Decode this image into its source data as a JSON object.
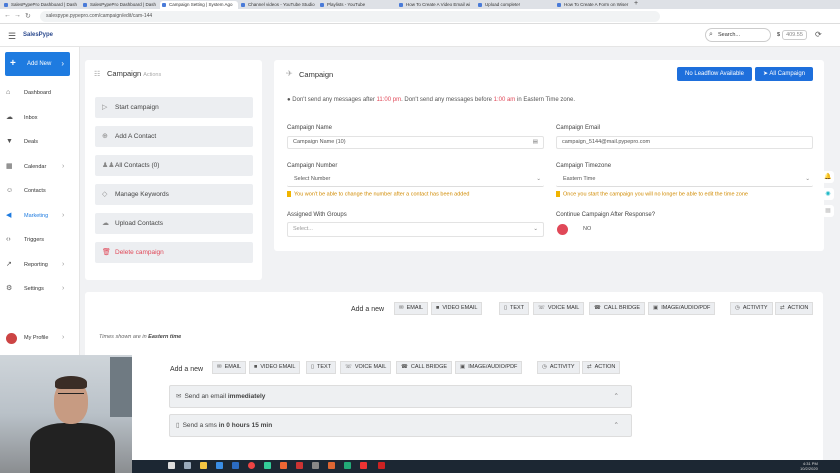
{
  "browser": {
    "tabs": [
      {
        "label": "SalesPypePro Dashboard | Dash",
        "active": false
      },
      {
        "label": "SalesPypePro Dashboard | Dash",
        "active": false
      },
      {
        "label": "Campaign Setting | System Ago",
        "active": true
      },
      {
        "label": "Channel videos - YouTube Studio",
        "active": false
      },
      {
        "label": "Playlists - YouTube",
        "active": false
      },
      {
        "label": "How To Create A Video Email wi",
        "active": false
      },
      {
        "label": "Upload complete!",
        "active": false
      },
      {
        "label": "How To Create A Form on Wiser",
        "active": false
      }
    ],
    "url": "salespype.pypepro.com/campaign/edit/cam-144"
  },
  "header": {
    "logo": "SalesPype",
    "search_placeholder": "Search...",
    "credits_symbol": "$",
    "credits_value": "409.55"
  },
  "sidebar": {
    "add_new": "Add New",
    "items": [
      {
        "label": "Dashboard",
        "icon": "home-icon",
        "chevron": false
      },
      {
        "label": "Inbox",
        "icon": "inbox-icon",
        "chevron": false
      },
      {
        "label": "Deals",
        "icon": "filter-icon",
        "chevron": false
      },
      {
        "label": "Calendar",
        "icon": "calendar-icon",
        "chevron": true
      },
      {
        "label": "Contacts",
        "icon": "contacts-icon",
        "chevron": false
      },
      {
        "label": "Marketing",
        "icon": "megaphone-icon",
        "chevron": true,
        "active": true
      },
      {
        "label": "Triggers",
        "icon": "code-icon",
        "chevron": false
      },
      {
        "label": "Reporting",
        "icon": "chart-icon",
        "chevron": true
      },
      {
        "label": "Settings",
        "icon": "gear-icon",
        "chevron": true
      }
    ],
    "profile": "My Profile"
  },
  "left_panel": {
    "title": "Campaign",
    "subtitle": "Actions",
    "items": [
      {
        "label": "Start campaign",
        "icon": "play-icon"
      },
      {
        "label": "Add A Contact",
        "icon": "add-contact-icon"
      },
      {
        "label": "All Contacts (0)",
        "icon": "users-icon"
      },
      {
        "label": "Manage Keywords",
        "icon": "tag-icon"
      },
      {
        "label": "Upload Contacts",
        "icon": "cloud-upload-icon"
      },
      {
        "label": "Delete campaign",
        "icon": "trash-icon"
      }
    ]
  },
  "right_panel": {
    "title": "Campaign",
    "btn_no_leadflow": "No Leadflow Available",
    "btn_all_campaign": "All Campaign",
    "warning_pre": "Don't send any messages after",
    "warning_after_time": "11:00 pm",
    "warning_mid": ". Don't send any messages before",
    "warning_before_time": "1:00 am",
    "warning_post": "in Eastern Time zone.",
    "campaign_name_label": "Campaign Name",
    "campaign_name_value": "Campaign Name (10)",
    "campaign_email_label": "Campaign Email",
    "campaign_email_value": "campaign_5144@mail.pypepro.com",
    "campaign_number_label": "Campaign Number",
    "campaign_number_value": "Select Number",
    "campaign_number_hint": "You won't be able to change the number after a contact has been added",
    "campaign_timezone_label": "Campaign Timezone",
    "campaign_timezone_value": "Eastern Time",
    "campaign_timezone_hint": "Once you start the campaign you will no longer be able to edit the time zone",
    "groups_label": "Assigned With Groups",
    "groups_placeholder": "Select...",
    "continue_label": "Continue Campaign After Response?",
    "continue_value": "NO"
  },
  "lower": {
    "add_new_label": "Add a new",
    "buttons": [
      "EMAIL",
      "VIDEO EMAIL",
      "TEXT",
      "VOICE MAIL",
      "CALL BRIDGE",
      "IMAGE/AUDIO/PDF",
      "ACTIVITY",
      "ACTION"
    ],
    "tz_prefix": "Times shown are in",
    "tz_value": "Eastern time",
    "add_new_label_2": "Add a new",
    "buttons_2": [
      "EMAIL",
      "VIDEO EMAIL",
      "TEXT",
      "VOICE MAIL",
      "CALL BRIDGE",
      "IMAGE/AUDIO/PDF",
      "ACTIVITY",
      "ACTION"
    ],
    "step1_pre": "Send an email",
    "step1_bold": "immediately",
    "step2_pre": "Send a sms",
    "step2_bold": "in 0 hours 15 min"
  },
  "taskbar": {
    "time": "4:31 PM",
    "date": "10/2/2020"
  },
  "colors": {
    "primary": "#1e7be0",
    "danger": "#e04858",
    "warning": "#d08a00"
  }
}
